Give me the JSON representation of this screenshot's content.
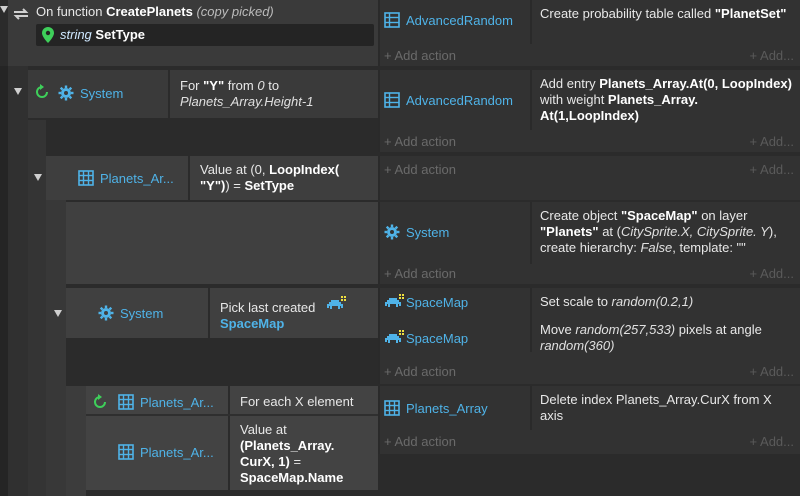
{
  "function_header": {
    "prefix": "On function ",
    "name": "CreatePlanets",
    "suffix": "(copy picked)",
    "param_type": "string",
    "param_name": "SetType"
  },
  "block1": {
    "actions": [
      {
        "object": "AdvancedRandom",
        "text_parts": [
          "Create probability table called ",
          "\"PlanetSet\""
        ]
      }
    ],
    "add_action": "Add action",
    "add_right": "Add..."
  },
  "block2": {
    "cond_object": "System",
    "cond_text_1": "For ",
    "cond_var": "\"Y\"",
    "cond_text_2": " from ",
    "cond_from": "0",
    "cond_text_3": " to",
    "cond_to": "Planets_Array.Height-1",
    "action_object": "AdvancedRandom",
    "action_text": {
      "p1": "Add entry ",
      "b1": "Planets_Array.At(0, LoopIndex)",
      "p2": " with weight ",
      "b2": "Planets_Array. At(1,LoopIndex)"
    },
    "add_action": "Add action",
    "add_right": "Add..."
  },
  "block3": {
    "cond_object": "Planets_Ar...",
    "cond_text_a": "Value at (0, ",
    "cond_text_b": "LoopIndex(",
    "cond_text_c": "\"Y\")",
    "cond_text_d": ") = ",
    "cond_text_e": "SetType",
    "add_action": "Add action",
    "add_right": "Add..."
  },
  "block4": {
    "action_object": "System",
    "action_text": {
      "p1": "Create object ",
      "b1": "\"SpaceMap\"",
      "p2": " on layer ",
      "b2": "\"Planets\"",
      "p3": " at (",
      "i1": "CitySprite.X, CitySprite. Y",
      "p4": "), create hierarchy: ",
      "i2": "False",
      "p5": ", template: \"\""
    },
    "add_action": "Add action",
    "add_right": "Add..."
  },
  "block5": {
    "cond_object": "System",
    "cond_text": "Pick last created",
    "cond_target": "SpaceMap",
    "actions": [
      {
        "object": "SpaceMap",
        "p1": "Set scale to ",
        "i1": "random(0.2,1)"
      },
      {
        "object": "SpaceMap",
        "p1": "Move ",
        "i1": "random(257,533)",
        "p2": " pixels at angle ",
        "i2": "random(360)"
      }
    ],
    "add_action": "Add action",
    "add_right": "Add..."
  },
  "block6": {
    "cond1_object": "Planets_Ar...",
    "cond1_text": "For each X element",
    "cond2_object": "Planets_Ar...",
    "cond2_text_a": "Value at",
    "cond2_text_b": "(Planets_Array. CurX, 1)",
    "cond2_text_c": " =",
    "cond2_text_d": "SpaceMap.Name",
    "action_object": "Planets_Array",
    "action_text": "Delete index Planets_Array.CurX from X axis",
    "add_action": "Add action",
    "add_right": "Add..."
  },
  "colors": {
    "accent_blue": "#4fb3e8",
    "location_green": "#3ecf5a",
    "loop_green": "#3ecf5a"
  }
}
